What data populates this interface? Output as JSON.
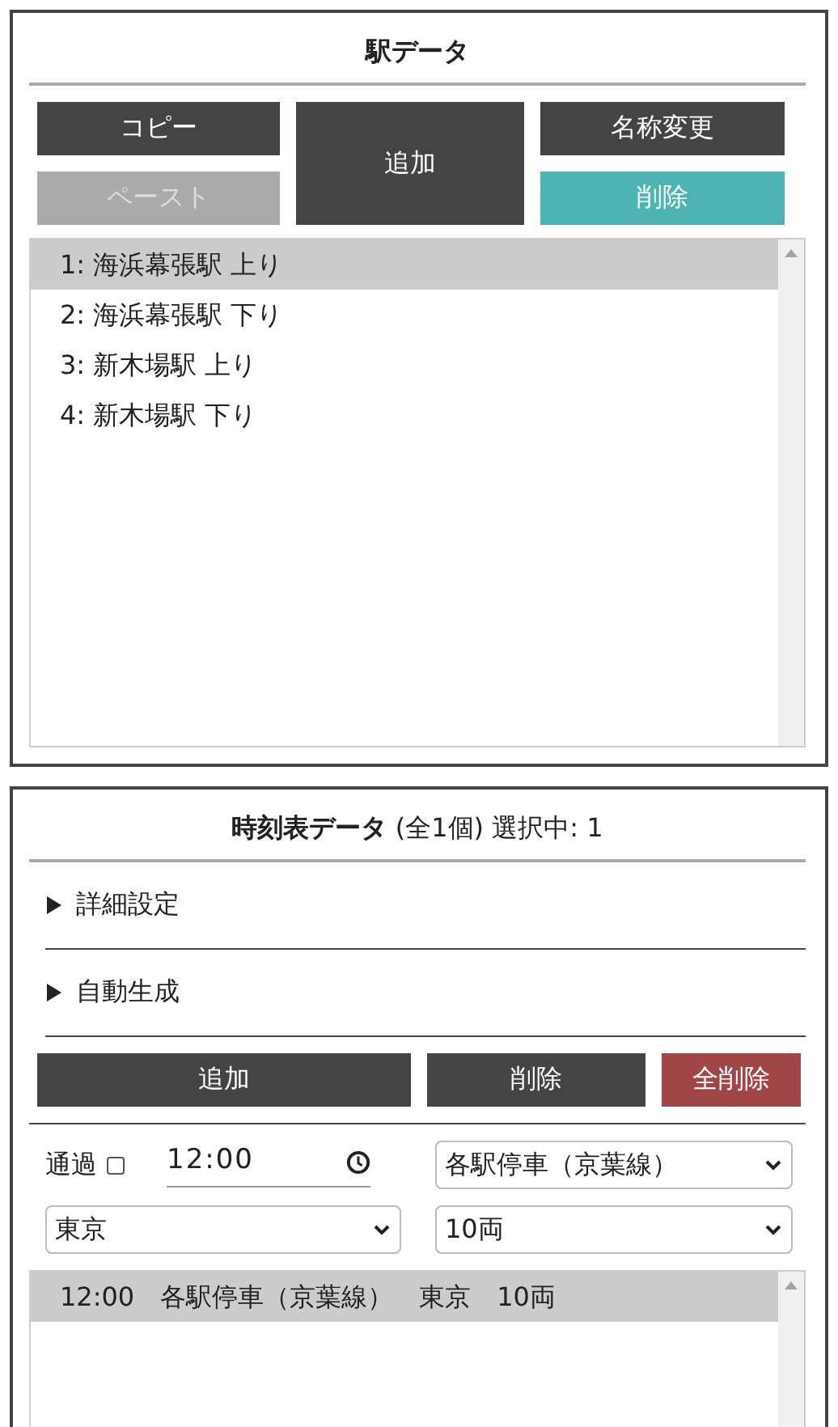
{
  "stations": {
    "title": "駅データ",
    "buttons": [
      {
        "label": "コピー",
        "kind": "copy",
        "disabled": false
      },
      {
        "label": "追加",
        "kind": "add",
        "disabled": false
      },
      {
        "label": "名称変更",
        "kind": "rename",
        "disabled": false
      },
      {
        "label": "ペースト",
        "kind": "paste",
        "disabled": true
      },
      {
        "label": "削除",
        "kind": "delete",
        "disabled": false
      }
    ],
    "items": [
      {
        "label": "1: 海浜幕張駅 上り",
        "selected": true
      },
      {
        "label": "2: 海浜幕張駅 下り",
        "selected": false
      },
      {
        "label": "3: 新木場駅 上り",
        "selected": false
      },
      {
        "label": "4: 新木場駅 下り",
        "selected": false
      }
    ]
  },
  "timetable": {
    "title": "時刻表データ",
    "count": "(全1個)",
    "selection": "選択中: 1",
    "sections": [
      {
        "label": "詳細設定",
        "expanded": false
      },
      {
        "label": "自動生成",
        "expanded": false
      }
    ],
    "buttons": [
      {
        "label": "追加",
        "kind": "add"
      },
      {
        "label": "削除",
        "kind": "delete"
      },
      {
        "label": "全削除",
        "kind": "clear"
      }
    ],
    "pass_label": "通過",
    "pass_checked": false,
    "time": "12:00",
    "train_type": "各駅停車（京葉線）",
    "destination": "東京",
    "cars": "10両",
    "rows": [
      {
        "label": "12:00　各駅停車（京葉線）　東京　10両",
        "selected": true
      }
    ]
  }
}
